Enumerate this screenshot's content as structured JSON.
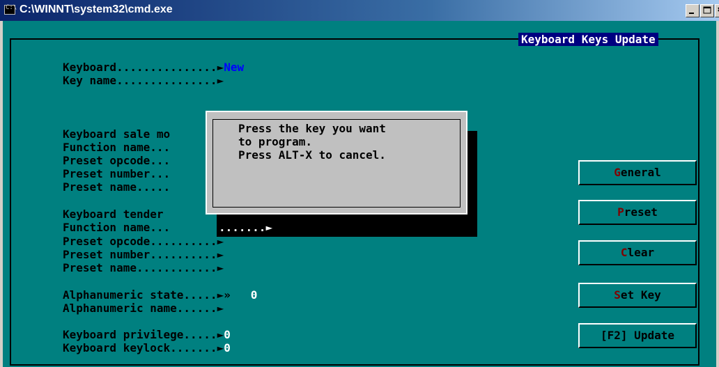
{
  "window": {
    "title": "C:\\WINNT\\system32\\cmd.exe",
    "icon_text": "C:\\",
    "icon": "console-icon",
    "buttons": {
      "minimize": "minimize-icon",
      "maximize": "maximize-icon",
      "close": "close-icon"
    }
  },
  "screen": {
    "heading": "Keyboard Keys Update",
    "fields": [
      {
        "label": "Keyboard...............",
        "arrow": "►",
        "value": "New"
      },
      {
        "label": "Key name...............",
        "arrow": "►",
        "value": ""
      },
      {
        "label": "Keyboard sale mo",
        "arrow": "",
        "value": ""
      },
      {
        "label": "Function name...",
        "arrow": "",
        "value": ""
      },
      {
        "label": "Preset opcode...",
        "arrow": "",
        "value": ""
      },
      {
        "label": "Preset number...",
        "arrow": "",
        "value": ""
      },
      {
        "label": "Preset name.....",
        "arrow": "",
        "value": ""
      },
      {
        "label": "Keyboard tender",
        "arrow": "",
        "value": ""
      },
      {
        "label": "Function name...",
        "arrow": "►",
        "value": "",
        "suffix": "......."
      },
      {
        "label": "Preset opcode..........",
        "arrow": "►",
        "value": ""
      },
      {
        "label": "Preset number..........",
        "arrow": "►",
        "value": ""
      },
      {
        "label": "Preset name............",
        "arrow": "►",
        "value": ""
      },
      {
        "label": "Alphanumeric state.....",
        "arrow": "►»",
        "value": "0"
      },
      {
        "label": "Alphanumeric name......",
        "arrow": "►",
        "value": ""
      },
      {
        "label": "Keyboard privilege.....",
        "arrow": "►",
        "value": "0"
      },
      {
        "label": "Keyboard keylock.......",
        "arrow": "►",
        "value": "0"
      }
    ]
  },
  "dialog": {
    "line1": "Press the key you want",
    "line2": "to program.",
    "line3": "Press ALT-X to cancel."
  },
  "buttons": [
    {
      "hot": "G",
      "rest": "eneral"
    },
    {
      "hot": "P",
      "rest": "reset"
    },
    {
      "hot": "C",
      "rest": "lear"
    },
    {
      "hot": "S",
      "rest": "et Key"
    },
    {
      "label": "[F2] Update"
    }
  ],
  "colors": {
    "console_bg": "#008080",
    "heading_bg": "#000080",
    "dialog_bg": "#c0c0c0",
    "hotkey": "#800000",
    "value_blue": "#0000ff"
  }
}
